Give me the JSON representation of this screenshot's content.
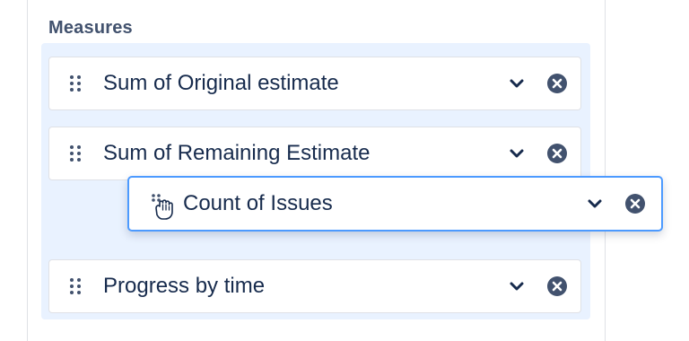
{
  "section": {
    "title": "Measures"
  },
  "measures": [
    {
      "label": "Sum of Original estimate"
    },
    {
      "label": "Sum of Remaining Estimate"
    },
    {
      "label": "Progress by time"
    }
  ],
  "dragging_item": {
    "label": "Count of Issues"
  },
  "icons": {
    "drag_handle": "drag-handle-icon",
    "chevron": "chevron-down-icon",
    "remove": "close-circle-icon",
    "grab_cursor": "grab-hand-icon"
  },
  "colors": {
    "dropzone_bg": "#e9f2ff",
    "drag_border": "#4c9aff",
    "text": "#172b4d",
    "title": "#42526e"
  }
}
